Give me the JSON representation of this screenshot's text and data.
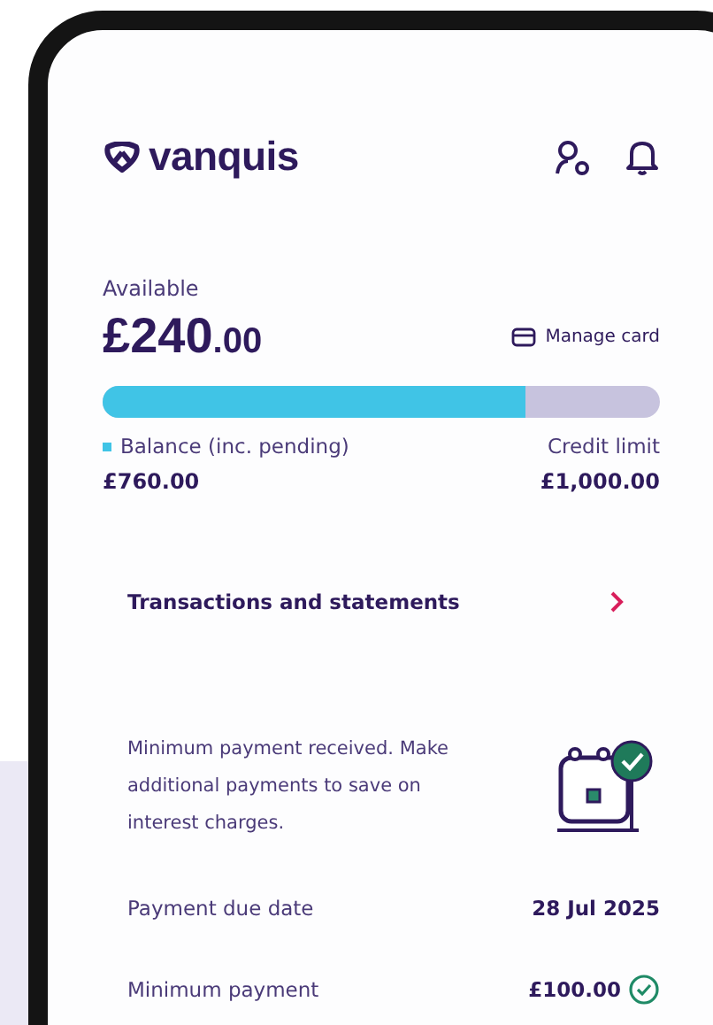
{
  "header": {
    "brand": "vanquis"
  },
  "balance": {
    "label": "Available",
    "whole": "£240",
    "pence": ".00",
    "manage_card": "Manage card",
    "level": 0.76,
    "legend": "Balance (inc. pending)",
    "balance_value": "£760.00",
    "limit_label": "Credit limit",
    "limit_value": "£1,000.00"
  },
  "transactions": {
    "label": "Transactions and statements"
  },
  "payment": {
    "message": "Minimum payment received. Make additional payments to save on interest charges.",
    "rows": [
      {
        "label": "Payment due date",
        "value": "28 Jul 2025",
        "paid": false
      },
      {
        "label": "Minimum payment",
        "value": "£100.00",
        "paid": true
      }
    ]
  }
}
